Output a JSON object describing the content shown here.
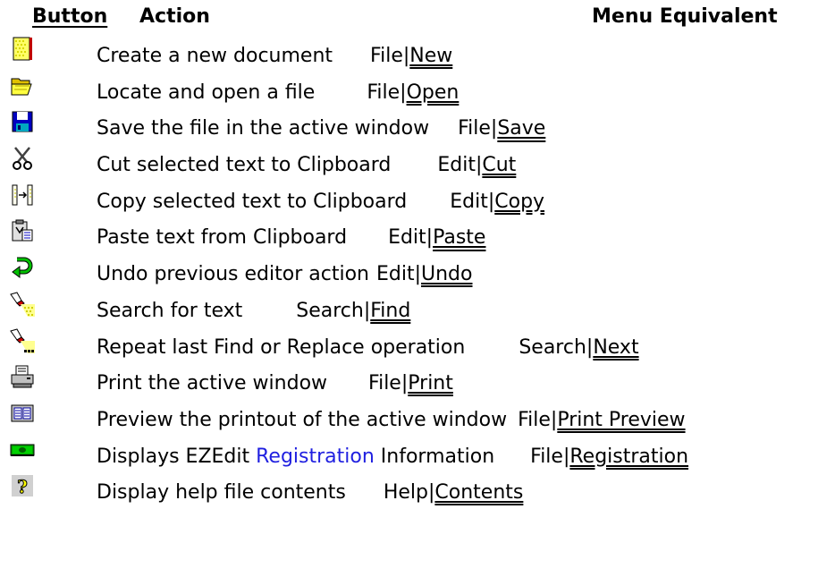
{
  "header": {
    "button_label": "Button",
    "action_label": "Action",
    "menu_label": "Menu Equivalent"
  },
  "rows": [
    {
      "icon": "new-document-icon",
      "action": "Create a new document",
      "menu_prefix": "File|",
      "menu_link": "New"
    },
    {
      "icon": "open-folder-icon",
      "action": "Locate and open a file",
      "menu_prefix": "File|",
      "menu_link": "Open"
    },
    {
      "icon": "floppy-disk-icon",
      "action": "Save the file in the active window",
      "menu_prefix": "File|",
      "menu_link": "Save"
    },
    {
      "icon": "scissors-icon",
      "action": "Cut selected text to Clipboard",
      "menu_prefix": "Edit|",
      "menu_link": "Cut"
    },
    {
      "icon": "copy-icon",
      "action": "Copy selected text to Clipboard",
      "menu_prefix": "Edit|",
      "menu_link": "Copy"
    },
    {
      "icon": "paste-icon",
      "action": "Paste text from Clipboard",
      "menu_prefix": "Edit|",
      "menu_link": "Paste"
    },
    {
      "icon": "undo-arrow-icon",
      "action": "Undo previous editor action",
      "menu_prefix": "Edit|",
      "menu_link": "Undo"
    },
    {
      "icon": "flashlight-icon",
      "action": "Search for text",
      "menu_prefix": "Search|",
      "menu_link": "Find"
    },
    {
      "icon": "flashlight-next-icon",
      "action": "Repeat last Find or Replace operation",
      "menu_prefix": "Search|",
      "menu_link": "Next"
    },
    {
      "icon": "printer-icon",
      "action": "Print the active window",
      "menu_prefix": "File|",
      "menu_link": "Print"
    },
    {
      "icon": "print-preview-icon",
      "action": "Preview the printout of the active window",
      "menu_prefix": "File|",
      "menu_link": "Print Preview"
    },
    {
      "icon": "money-icon",
      "action_before": "Displays EZEdit ",
      "action_link": "Registration",
      "action_after": " Information",
      "menu_prefix": "File|",
      "menu_link": "Registration"
    },
    {
      "icon": "help-question-icon",
      "action": "Display help file contents",
      "menu_prefix": "Help|",
      "menu_link": "Contents"
    }
  ]
}
